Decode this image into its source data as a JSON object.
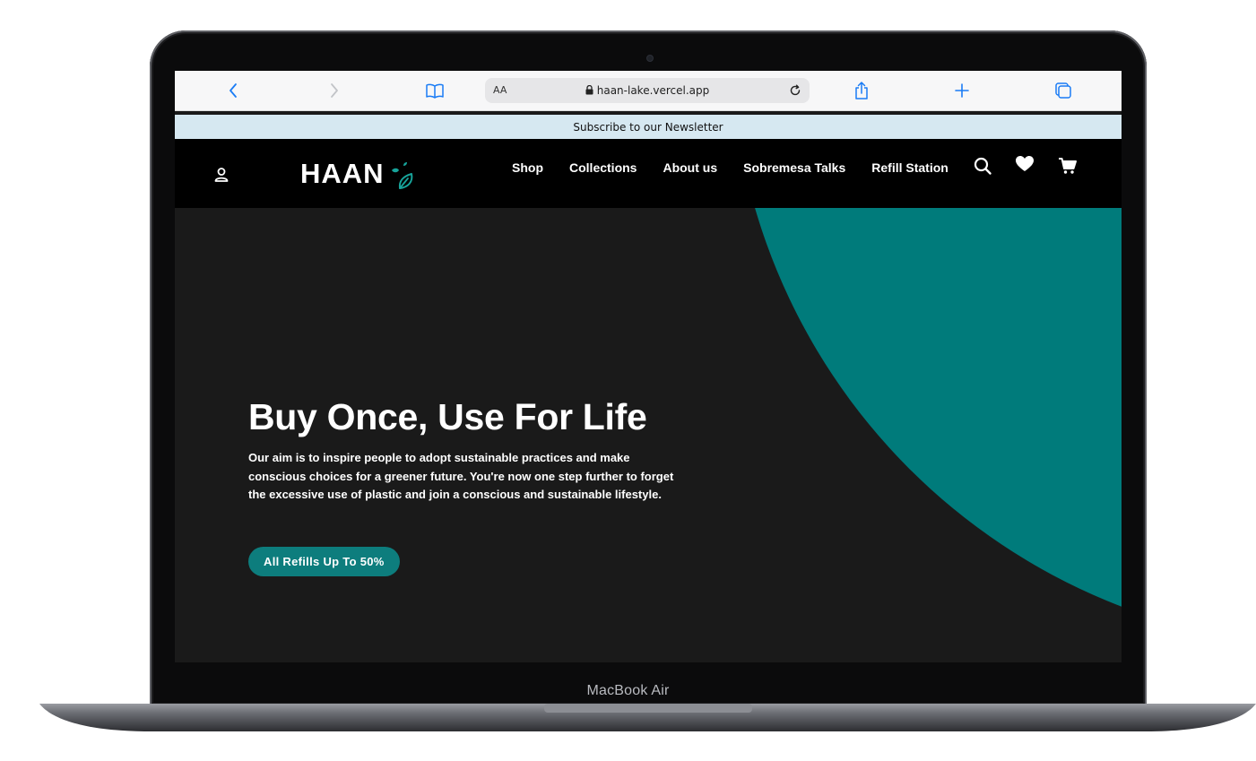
{
  "browser": {
    "reader_label": "AA",
    "url": "haan-lake.vercel.app",
    "accent_color": "#1a7cf5",
    "icons": [
      "chevron-left-icon",
      "chevron-right-icon",
      "book-icon",
      "lock-icon",
      "reload-icon",
      "share-icon",
      "plus-icon",
      "tabs-icon"
    ]
  },
  "newsletter": {
    "text": "Subscribe to our Newsletter",
    "background": "#d6e8f1"
  },
  "header": {
    "logo_text": "HAAN",
    "nav": [
      "Shop",
      "Collections",
      "About us",
      "Sobremesa Talks",
      "Refill Station"
    ],
    "icons": [
      "user-icon",
      "search-icon",
      "heart-icon",
      "cart-icon"
    ]
  },
  "hero": {
    "title": "Buy Once, Use For Life",
    "description": "Our aim is to inspire people to adopt sustainable practices and make conscious choices for a greener future. You're now one step further to forget the excessive use of plastic and join a conscious and sustainable lifestyle.",
    "cta_label": "All Refills Up To 50%",
    "accent_color": "#0d7d7d",
    "background": "#1a1a1a"
  },
  "device": {
    "label": "MacBook Air"
  }
}
